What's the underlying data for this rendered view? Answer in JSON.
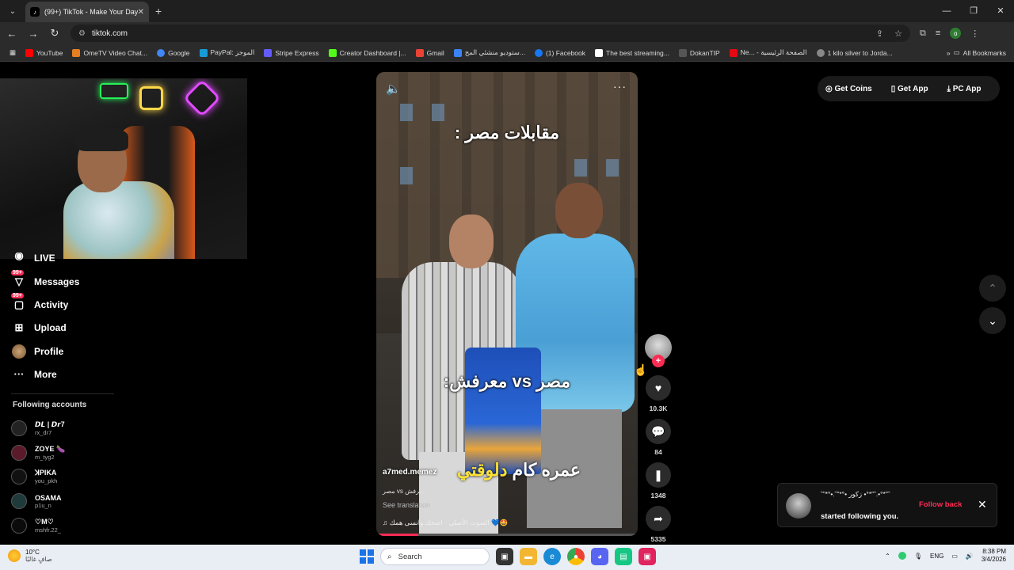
{
  "browser": {
    "tab_title": "(99+) TikTok - Make Your Day",
    "url": "tiktok.com",
    "bookmarks": [
      "YouTube",
      "OmeTV Video Chat...",
      "Google",
      "PayPal: الموجز",
      "Stripe Express",
      "Creator Dashboard |...",
      "Gmail",
      "ستوديو منشئي المح...",
      "(1) Facebook",
      "The best streaming...",
      "DokanTIP",
      "Ne... - الصفحة الرئيسية",
      "1 kilo silver to Jorda..."
    ],
    "all_bookmarks": "All Bookmarks",
    "profile_letter": "o"
  },
  "sidebar": {
    "live": "LIVE",
    "messages": "Messages",
    "activity": "Activity",
    "upload": "Upload",
    "profile": "Profile",
    "more": "More",
    "badge": "99+",
    "following_header": "Following accounts",
    "accounts": [
      {
        "name": "𝘿𝙇 | 𝘿𝙧7",
        "user": "rx_dr7"
      },
      {
        "name": "ZOYE 🍆",
        "user": "m_tyg2"
      },
      {
        "name": "ꓘPIKA",
        "user": "you_pkh"
      },
      {
        "name": "OSAMA",
        "user": "p1u_n"
      },
      {
        "name": "♡M♡",
        "user": "mshfr.22_"
      }
    ]
  },
  "video": {
    "text_top": "مقابلات مصر :",
    "text_mid": "مصر vs معرفش:",
    "text_bottom_white": "عمره كام",
    "text_bottom_yellow": "دلوقتي",
    "author": "a7med.memez",
    "description": "مصر vs معرفش",
    "see_translation": "See translation",
    "music": "♫  الصوت الأصلي - اضحك وانسى همك 💙🤩",
    "progress": 0.16
  },
  "actions": {
    "likes": "10.3K",
    "comments": "84",
    "saves": "1348",
    "shares": "5335"
  },
  "topright": {
    "coins": "Get Coins",
    "app": "Get App",
    "pc": "PC App"
  },
  "toast": {
    "name": "˜”*°•.˜”*°• زكور •°*”˜.•°*”˜",
    "text": "started following you.",
    "follow_back": "Follow back"
  },
  "taskbar": {
    "temp": "10°C",
    "weather_desc": "صافٍ غالبًا",
    "search": "Search",
    "lang": "ENG",
    "time": "8:38 PM",
    "date": "3/4/2026"
  }
}
